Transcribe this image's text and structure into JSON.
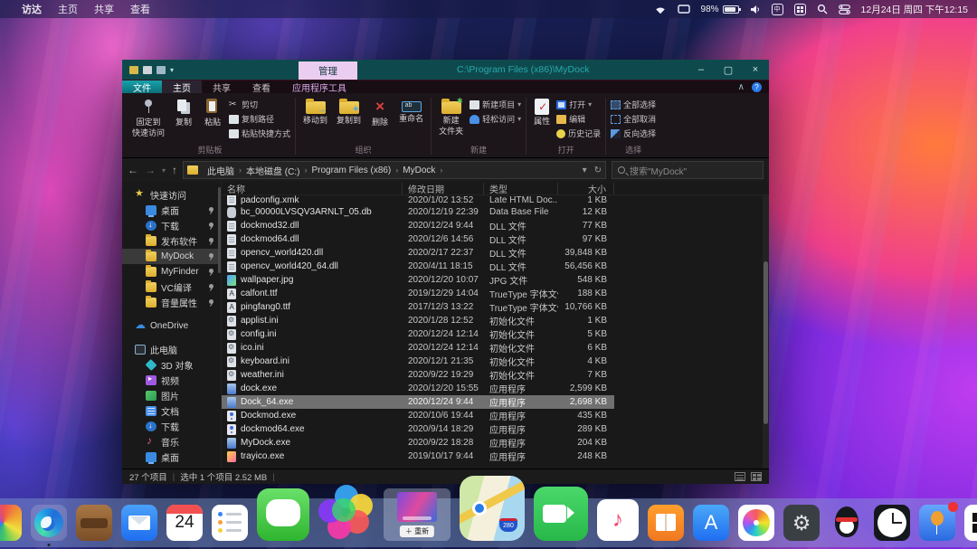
{
  "menubar": {
    "apple_logo": "",
    "items": [
      {
        "label": "访达",
        "cls": "first"
      },
      {
        "label": "主页",
        "cls": ""
      },
      {
        "label": "共享",
        "cls": ""
      },
      {
        "label": "查看",
        "cls": ""
      }
    ],
    "battery_percent": "98%",
    "clock": "12月24日 周四 下午12:15",
    "status_icons": [
      "wifi-icon",
      "display-icon",
      "battery-icon",
      "volume-icon",
      "input-method-icon",
      "launchpad-grid-icon",
      "search-icon",
      "control-center-icon"
    ]
  },
  "window": {
    "titlebar": {
      "tab_manage": "管理",
      "title": "C:\\Program Files (x86)\\MyDock",
      "minimize": "–",
      "maximize": "▢",
      "close": "×"
    },
    "ribbon_tabs": {
      "file": "文件",
      "home": "主页",
      "share": "共享",
      "view": "查看",
      "apptools": "应用程序工具",
      "collapse": "∧",
      "help": "?"
    },
    "ribbon": {
      "btn_pin_1": "固定到",
      "btn_pin_2": "快速访问",
      "btn_copy": "复制",
      "btn_paste": "粘贴",
      "btn_cut": "剪切",
      "btn_copy_path": "复制路径",
      "btn_paste_shortcut": "粘贴快捷方式",
      "group_clipboard": "剪贴板",
      "btn_move_to": "移动到",
      "btn_copy_to": "复制到",
      "btn_delete": "删除",
      "btn_rename": "重命名",
      "group_organize": "组织",
      "btn_new_folder_1": "新建",
      "btn_new_folder_2": "文件夹",
      "btn_new_item": "新建项目",
      "btn_easy_access": "轻松访问",
      "group_new": "新建",
      "btn_properties": "属性",
      "btn_open": "打开",
      "btn_edit": "编辑",
      "btn_history": "历史记录",
      "group_open": "打开",
      "btn_select_all": "全部选择",
      "btn_select_none": "全部取消",
      "btn_invert_selection": "反向选择",
      "group_select": "选择"
    },
    "addressbar": {
      "back": "←",
      "forward": "→",
      "dropdown": "▾",
      "up": "↑",
      "crumbs": [
        {
          "label": "此电脑"
        },
        {
          "label": "本地磁盘 (C:)"
        },
        {
          "label": "Program Files (x86)"
        },
        {
          "label": "MyDock"
        }
      ],
      "refresh": "↻",
      "search_placeholder": "搜索\"MyDock\""
    },
    "sidebar": {
      "items": [
        {
          "label": "快速访问",
          "icon": "star",
          "cls": "d0"
        },
        {
          "label": "桌面",
          "icon": "desktop",
          "cls": "d1 pinned"
        },
        {
          "label": "下载",
          "icon": "download",
          "cls": "d1 pinned"
        },
        {
          "label": "发布软件",
          "icon": "folder",
          "cls": "d1 pinned"
        },
        {
          "label": "MyDock",
          "icon": "folder",
          "cls": "d1 pinned sel"
        },
        {
          "label": "MyFinder",
          "icon": "folder",
          "cls": "d1 pinned"
        },
        {
          "label": "VC编译",
          "icon": "folder",
          "cls": "d1 pinned"
        },
        {
          "label": "音量属性",
          "icon": "folder",
          "cls": "d1 pinned"
        },
        {
          "label": "OneDrive",
          "icon": "cloud",
          "cls": "d0 gap"
        },
        {
          "label": "此电脑",
          "icon": "pc",
          "cls": "d0 gap"
        },
        {
          "label": "3D 对象",
          "icon": "cube",
          "cls": "d1"
        },
        {
          "label": "视频",
          "icon": "video",
          "cls": "d1"
        },
        {
          "label": "图片",
          "icon": "image",
          "cls": "d1"
        },
        {
          "label": "文档",
          "icon": "doc",
          "cls": "d1"
        },
        {
          "label": "下载",
          "icon": "download",
          "cls": "d1"
        },
        {
          "label": "音乐",
          "icon": "music",
          "cls": "d1"
        },
        {
          "label": "桌面",
          "icon": "desktop",
          "cls": "d1"
        }
      ]
    },
    "filelist": {
      "columns": {
        "name": "名称",
        "date": "修改日期",
        "type": "类型",
        "size": "大小"
      },
      "rows": [
        {
          "ic": "page",
          "name": "padconfig.xmk",
          "date": "2020/1/02 13:52",
          "type": "Late HTML Doc...",
          "size": "1 KB",
          "cls": "partial"
        },
        {
          "ic": "db",
          "name": "bc_00000LVSQV3ARNLT_05.db",
          "date": "2020/12/19 22:39",
          "type": "Data Base File",
          "size": "12 KB",
          "cls": ""
        },
        {
          "ic": "page",
          "name": "dockmod32.dll",
          "date": "2020/12/24 9:44",
          "type": "DLL 文件",
          "size": "77 KB",
          "cls": ""
        },
        {
          "ic": "page",
          "name": "dockmod64.dll",
          "date": "2020/12/6 14:56",
          "type": "DLL 文件",
          "size": "97 KB",
          "cls": ""
        },
        {
          "ic": "page",
          "name": "opencv_world420.dll",
          "date": "2020/2/17 22:37",
          "type": "DLL 文件",
          "size": "39,848 KB",
          "cls": ""
        },
        {
          "ic": "page",
          "name": "opencv_world420_64.dll",
          "date": "2020/4/11 18:15",
          "type": "DLL 文件",
          "size": "56,456 KB",
          "cls": ""
        },
        {
          "ic": "img",
          "name": "wallpaper.jpg",
          "date": "2020/12/20 10:07",
          "type": "JPG 文件",
          "size": "548 KB",
          "cls": ""
        },
        {
          "ic": "font",
          "name": "calfont.ttf",
          "date": "2019/12/29 14:04",
          "type": "TrueType 字体文件",
          "size": "188 KB",
          "cls": ""
        },
        {
          "ic": "font",
          "name": "pingfang0.ttf",
          "date": "2017/12/3 13:22",
          "type": "TrueType 字体文件",
          "size": "10,766 KB",
          "cls": ""
        },
        {
          "ic": "ini",
          "name": "applist.ini",
          "date": "2020/1/28 12:52",
          "type": "初始化文件",
          "size": "1 KB",
          "cls": ""
        },
        {
          "ic": "ini",
          "name": "config.ini",
          "date": "2020/12/24 12:14",
          "type": "初始化文件",
          "size": "5 KB",
          "cls": ""
        },
        {
          "ic": "ini",
          "name": "ico.ini",
          "date": "2020/12/24 12:14",
          "type": "初始化文件",
          "size": "6 KB",
          "cls": ""
        },
        {
          "ic": "ini",
          "name": "keyboard.ini",
          "date": "2020/12/1 21:35",
          "type": "初始化文件",
          "size": "4 KB",
          "cls": ""
        },
        {
          "ic": "ini",
          "name": "weather.ini",
          "date": "2020/9/22 19:29",
          "type": "初始化文件",
          "size": "7 KB",
          "cls": ""
        },
        {
          "ic": "app-dock",
          "name": "dock.exe",
          "date": "2020/12/20 15:55",
          "type": "应用程序",
          "size": "2,599 KB",
          "cls": ""
        },
        {
          "ic": "app-dock",
          "name": "Dock_64.exe",
          "date": "2020/12/24 9:44",
          "type": "应用程序",
          "size": "2,698 KB",
          "cls": "sel"
        },
        {
          "ic": "app-mod",
          "name": "Dockmod.exe",
          "date": "2020/10/6 19:44",
          "type": "应用程序",
          "size": "435 KB",
          "cls": ""
        },
        {
          "ic": "app-mod",
          "name": "dockmod64.exe",
          "date": "2020/9/14 18:29",
          "type": "应用程序",
          "size": "289 KB",
          "cls": ""
        },
        {
          "ic": "app-dock",
          "name": "MyDock.exe",
          "date": "2020/9/22 18:28",
          "type": "应用程序",
          "size": "204 KB",
          "cls": ""
        },
        {
          "ic": "app-tray",
          "name": "trayico.exe",
          "date": "2019/10/17 9:44",
          "type": "应用程序",
          "size": "248 KB",
          "cls": ""
        }
      ]
    },
    "statusbar": {
      "items_count": "27 个项目",
      "selection": "选中 1 个项目 2.52 MB"
    }
  },
  "dock": {
    "calendar_day": "24",
    "thumbnail_label": "＋ 重新",
    "maps_shield": "280",
    "music_note": "♪",
    "appstore_letter": "A",
    "settings_gear": "⚙",
    "mail_glyph": "",
    "icons": [
      "partial-app",
      "edge-browser",
      "wallet",
      "mail",
      "calendar",
      "reminders",
      "messages",
      "color-circles",
      "minimized-window",
      "maps",
      "facetime",
      "music",
      "books",
      "app-store",
      "photos",
      "settings",
      "qq",
      "clock",
      "balloon-app",
      "windows-start"
    ]
  }
}
